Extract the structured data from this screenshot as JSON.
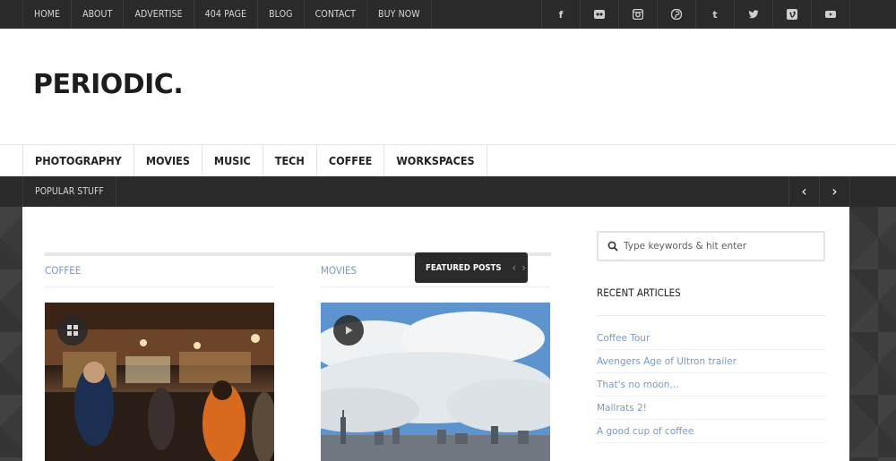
{
  "top_nav": [
    "HOME",
    "ABOUT",
    "ADVERTISE",
    "404 PAGE",
    "BLOG",
    "CONTACT",
    "BUY NOW"
  ],
  "social": [
    "facebook-icon",
    "flickr-icon",
    "instagram-icon",
    "pinterest-icon",
    "tumblr-icon",
    "twitter-icon",
    "vimeo-icon",
    "youtube-icon"
  ],
  "logo": "PERIODIC.",
  "categories": [
    "PHOTOGRAPHY",
    "MOVIES",
    "MUSIC",
    "TECH",
    "COFFEE",
    "WORKSPACES"
  ],
  "popular": {
    "label": "POPULAR STUFF",
    "prev": "‹",
    "next": "›"
  },
  "main": {
    "columns": [
      {
        "label": "COFFEE",
        "badge": "gallery-icon"
      },
      {
        "label": "MOVIES",
        "badge": "play-icon"
      }
    ],
    "featured": {
      "label": "FEATURED POSTS",
      "prev": "‹",
      "next": "›"
    }
  },
  "sidebar": {
    "search_placeholder": "Type keywords & hit enter",
    "recent_title": "RECENT ARTICLES",
    "recent": [
      "Coffee Tour",
      "Avengers Age of Ultron trailer",
      "That's no moon…",
      "Mallrats 2!",
      "A good cup of coffee"
    ]
  },
  "colors": {
    "dark_bar": "#2a2a2a",
    "link_blue": "#7a9ac0"
  }
}
